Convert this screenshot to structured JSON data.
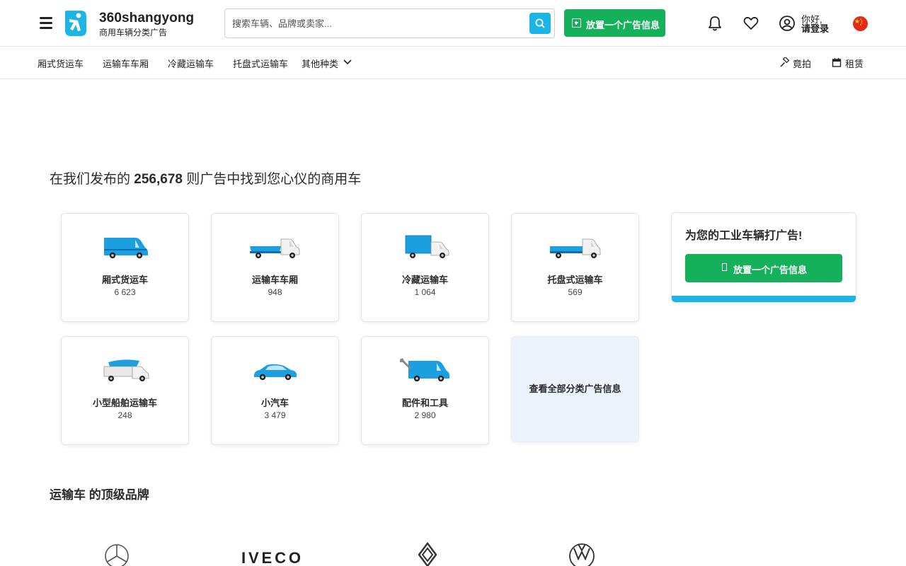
{
  "header": {
    "logo_name": "360shangyong",
    "logo_tagline": "商用车辆分类广告",
    "search_placeholder": "搜索车辆、品牌或卖家...",
    "post_ad_label": "放置一个广告信息",
    "user_greeting": "你好,",
    "user_login": "请登录",
    "icons": [
      "menu-icon",
      "search-icon",
      "bell-icon",
      "heart-icon",
      "user-icon",
      "china-flag-icon"
    ],
    "accent_color": "#1bb5e6",
    "button_color": "#14b05a"
  },
  "nav": {
    "items": [
      {
        "label": "厢式货运车"
      },
      {
        "label": "运输车车厢"
      },
      {
        "label": "冷藏运输车"
      },
      {
        "label": "托盘式运输车"
      },
      {
        "label": "其他种类"
      }
    ],
    "auction_label": "竟拍",
    "rental_label": "租赁"
  },
  "main": {
    "headline_prefix": "在我们发布的",
    "headline_count": "256,678",
    "headline_suffix": "则广告中找到您心仪的商用车",
    "categories": [
      {
        "name": "厢式货运车",
        "count": "6 623",
        "icon": "van-icon"
      },
      {
        "name": "运输车车厢",
        "count": "948",
        "icon": "dropside-truck-icon"
      },
      {
        "name": "冷藏运输车",
        "count": "1 064",
        "icon": "refrigerated-truck-icon"
      },
      {
        "name": "托盘式运输车",
        "count": "569",
        "icon": "flatbed-truck-icon"
      },
      {
        "name": "小型船舶运输车",
        "count": "248",
        "icon": "boat-transporter-icon"
      },
      {
        "name": "小汽车",
        "count": "3 479",
        "icon": "car-icon"
      },
      {
        "name": "配件和工具",
        "count": "2 980",
        "icon": "parts-tools-icon"
      }
    ],
    "view_all_label": "查看全部分类广告信息",
    "promo": {
      "title": "为您的工业车辆打广告!",
      "button_label": "放置一个广告信息"
    },
    "brands_title": "运输车 的顶级品牌",
    "brands": [
      {
        "name": "Mercedes-Benz",
        "icon": "mercedes-logo-icon"
      },
      {
        "name": "IVECO",
        "icon": "iveco-logo-icon"
      },
      {
        "name": "Renault",
        "icon": "renault-logo-icon"
      },
      {
        "name": "Volkswagen",
        "icon": "volkswagen-logo-icon"
      }
    ]
  }
}
